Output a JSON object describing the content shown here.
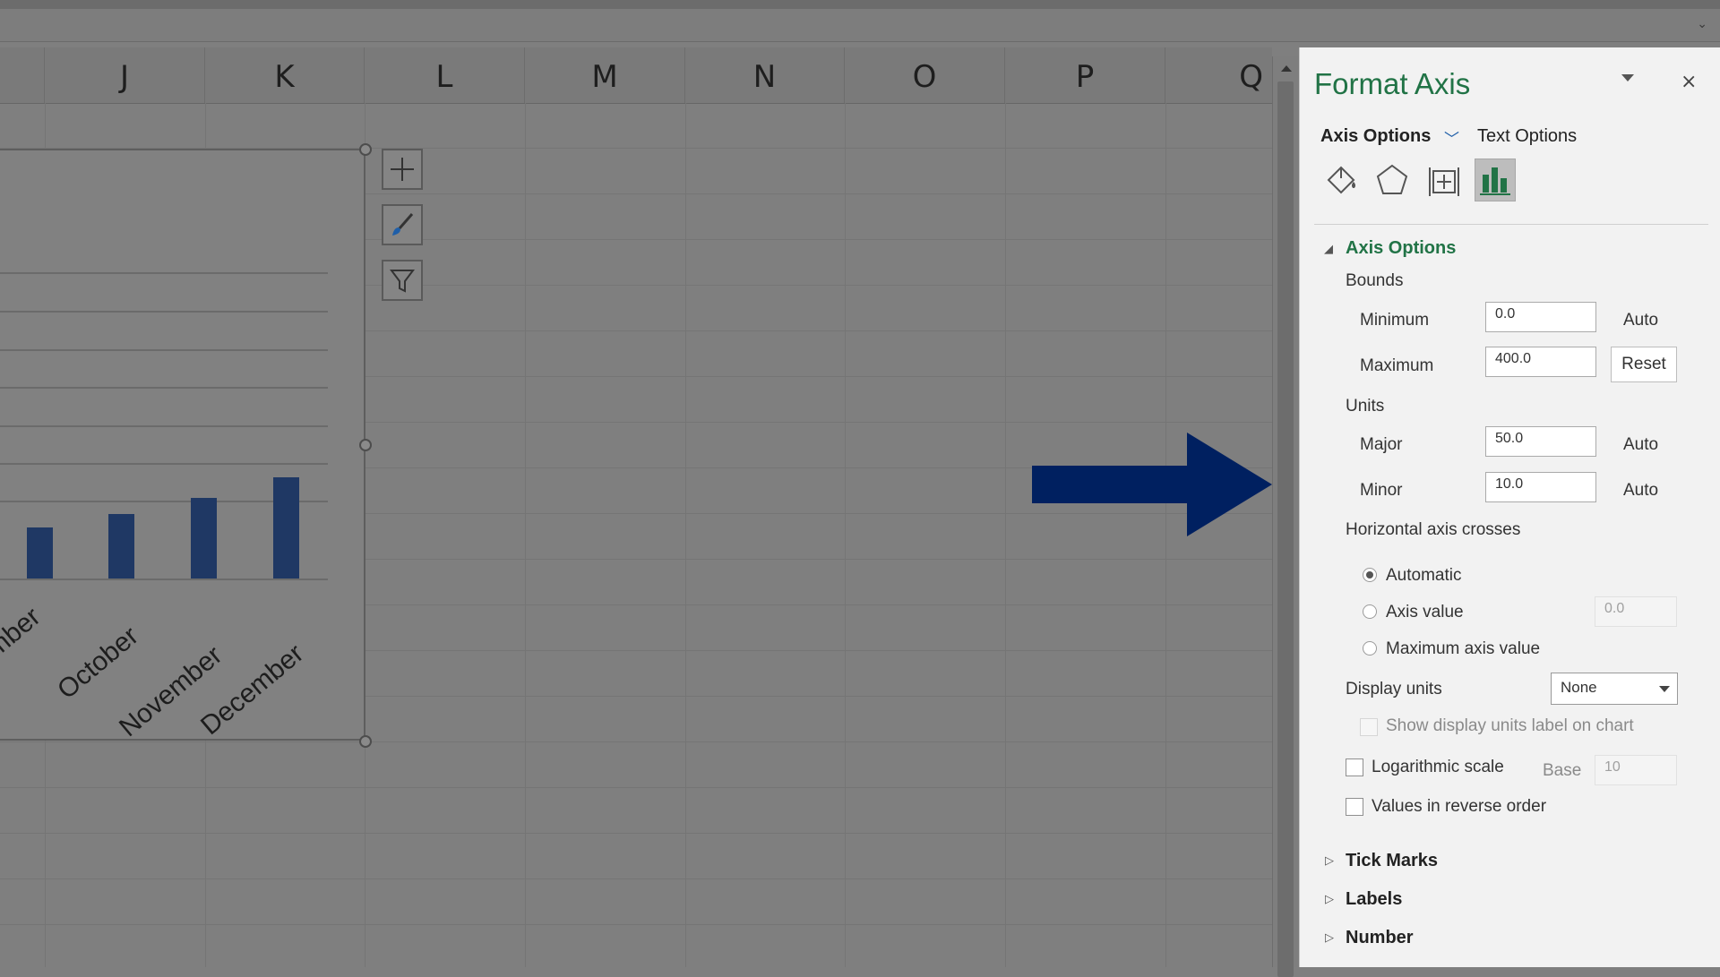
{
  "sheet": {
    "columns": [
      "J",
      "K",
      "L",
      "M",
      "N",
      "O",
      "P",
      "Q"
    ]
  },
  "chart": {
    "categories": [
      "mber",
      "October",
      "November",
      "December"
    ],
    "values": [
      0.38,
      0.48,
      0.6,
      0.75
    ]
  },
  "panel": {
    "title": "Format Axis",
    "close_label": "×",
    "tabs": {
      "axis_options": "Axis Options",
      "text_options": "Text Options"
    },
    "icons": [
      "fill-line-icon",
      "effects-icon",
      "size-properties-icon",
      "axis-options-icon"
    ],
    "section": "Axis Options",
    "bounds_label": "Bounds",
    "minimum": {
      "label": "Minimum",
      "value": "0.0",
      "state": "Auto"
    },
    "maximum": {
      "label": "Maximum",
      "value": "400.0",
      "button": "Reset"
    },
    "units_label": "Units",
    "major": {
      "label": "Major",
      "value": "50.0",
      "state": "Auto"
    },
    "minor": {
      "label": "Minor",
      "value": "10.0",
      "state": "Auto"
    },
    "crosses_label": "Horizontal axis crosses",
    "crosses_options": [
      "Automatic",
      "Axis value",
      "Maximum axis value"
    ],
    "crosses_selected": "Automatic",
    "axis_value": "0.0",
    "display_units_label": "Display units",
    "display_units_value": "None",
    "show_units_label": "Show display units label on chart",
    "log_scale_label": "Logarithmic scale",
    "base_label": "Base",
    "base_value": "10",
    "reverse_label": "Values in reverse order",
    "collapsed_sections": [
      "Tick Marks",
      "Labels",
      "Number"
    ]
  },
  "colors": {
    "accent": "#217346",
    "bar": "#1f3864",
    "arrow": "#002060"
  }
}
